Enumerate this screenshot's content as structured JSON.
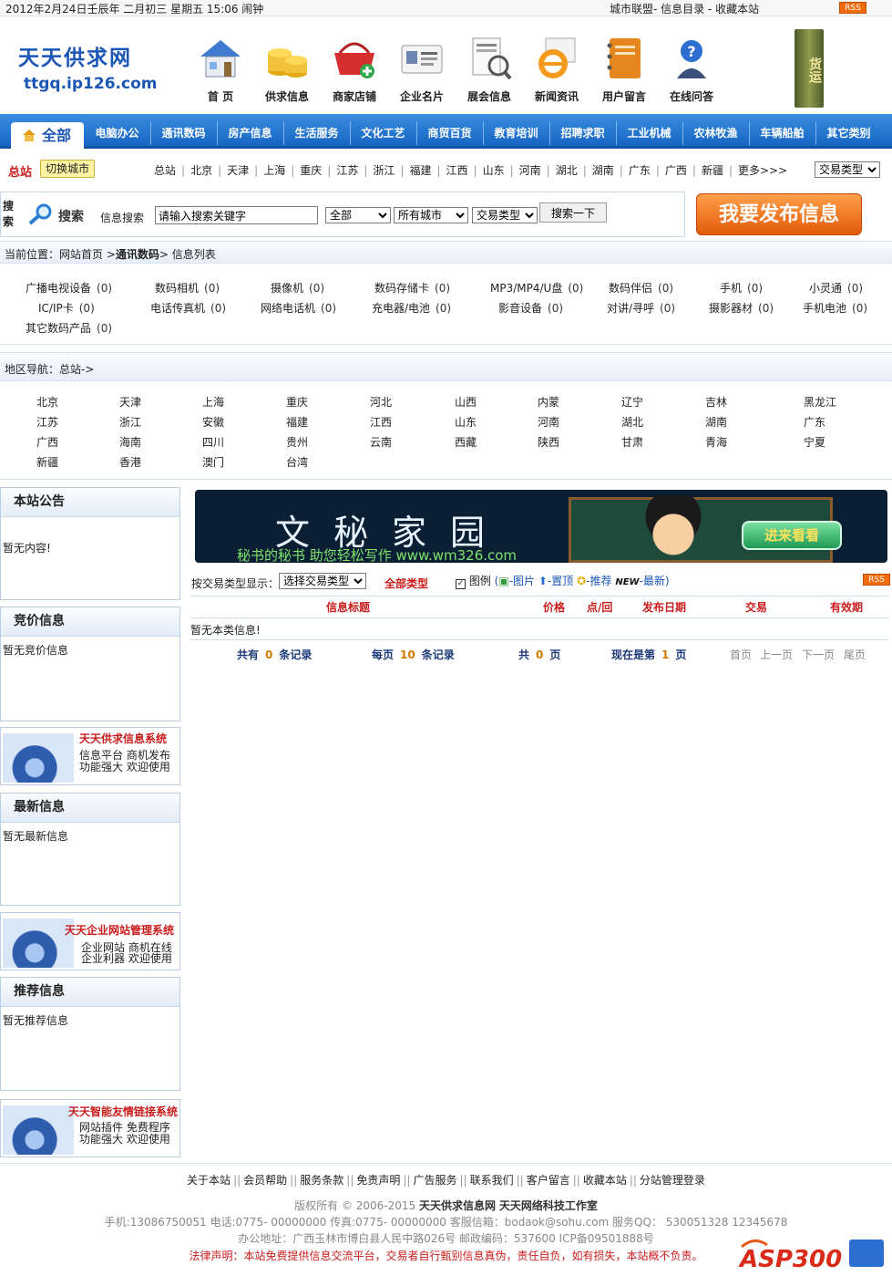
{
  "topbar": {
    "date": "2012年2月24日壬辰年 二月初三 星期五 15:06 闹钟",
    "links": "城市联盟- 信息目录 - 收藏本站",
    "rss": "RSS"
  },
  "header": {
    "logo_cn": "天天供求网",
    "logo_url": "ttgq.ip126.com",
    "nav": [
      {
        "label": "首 页",
        "icon": "house-icon"
      },
      {
        "label": "供求信息",
        "icon": "coins-icon"
      },
      {
        "label": "商家店铺",
        "icon": "basket-icon"
      },
      {
        "label": "企业名片",
        "icon": "business-card-icon"
      },
      {
        "label": "展会信息",
        "icon": "document-barcode-icon"
      },
      {
        "label": "新闻资讯",
        "icon": "news-e-icon"
      },
      {
        "label": "用户留言",
        "icon": "notebook-icon"
      },
      {
        "label": "在线问答",
        "icon": "help-person-icon"
      }
    ],
    "ad_right": "货运"
  },
  "categories": {
    "all": "全部",
    "items": [
      "电脑办公",
      "通讯数码",
      "房产信息",
      "生活服务",
      "文化工艺",
      "商贸百货",
      "教育培训",
      "招聘求职",
      "工业机械",
      "农林牧渔",
      "车辆船舶",
      "其它类别"
    ]
  },
  "cityrow": {
    "label": "总站",
    "switch": "切换城市",
    "cities": [
      "总站",
      "北京",
      "天津",
      "上海",
      "重庆",
      "江苏",
      "浙江",
      "福建",
      "江西",
      "山东",
      "河南",
      "湖北",
      "湖南",
      "广东",
      "广西",
      "新疆"
    ],
    "more": "更多>>>",
    "trade_select": "交易类型"
  },
  "search": {
    "sou": "搜索",
    "title": "搜索",
    "label": "信息搜索",
    "keyword": "请输入搜索关键字",
    "scope": "全部",
    "city": "所有城市",
    "trade": "交易类型",
    "button": "搜索一下",
    "publish": "我要发布信息"
  },
  "crumb": {
    "prefix": "当前位置：",
    "home": "网站首页",
    "sep": " >",
    "cat": "通讯数码",
    "sep2": "> ",
    "page": "信息列表"
  },
  "subcats": [
    {
      "name": "广播电视设备",
      "count": "(0)"
    },
    {
      "name": "数码相机",
      "count": "(0)"
    },
    {
      "name": "摄像机",
      "count": "(0)"
    },
    {
      "name": "数码存储卡",
      "count": "(0)"
    },
    {
      "name": "MP3/MP4/U盘",
      "count": "(0)"
    },
    {
      "name": "数码伴侣",
      "count": "(0)"
    },
    {
      "name": "手机",
      "count": "(0)"
    },
    {
      "name": "小灵通",
      "count": "(0)"
    },
    {
      "name": "IC/IP卡",
      "count": "(0)"
    },
    {
      "name": "电话传真机",
      "count": "(0)"
    },
    {
      "name": "网络电话机",
      "count": "(0)"
    },
    {
      "name": "充电器/电池",
      "count": "(0)"
    },
    {
      "name": "影音设备",
      "count": "(0)"
    },
    {
      "name": "对讲/寻呼",
      "count": "(0)"
    },
    {
      "name": "摄影器材",
      "count": "(0)"
    },
    {
      "name": "手机电池",
      "count": "(0)"
    },
    {
      "name": "其它数码产品",
      "count": "(0)"
    }
  ],
  "region": {
    "label": "地区导航：总站->",
    "provinces": [
      "北京",
      "天津",
      "上海",
      "重庆",
      "河北",
      "山西",
      "内蒙",
      "辽宁",
      "吉林",
      "黑龙江",
      "江苏",
      "浙江",
      "安徽",
      "福建",
      "江西",
      "山东",
      "河南",
      "湖北",
      "湖南",
      "广东",
      "广西",
      "海南",
      "四川",
      "贵州",
      "云南",
      "西藏",
      "陕西",
      "甘肃",
      "青海",
      "宁夏",
      "新疆",
      "香港",
      "澳门",
      "台湾"
    ]
  },
  "sidebar": {
    "notice": {
      "title": "本站公告",
      "body": "暂无内容!"
    },
    "bid": {
      "title": "竞价信息",
      "body": "暂无竞价信息"
    },
    "promo1": {
      "title": "天天供求信息系统",
      "line1": "信息平台 商机发布",
      "line2": "功能强大 欢迎使用"
    },
    "latest": {
      "title": "最新信息",
      "body": "暂无最新信息"
    },
    "promo2": {
      "title": "天天企业网站管理系统",
      "line1": "企业网站 商机在线",
      "line2": "企业利器 欢迎使用"
    },
    "recommend": {
      "title": "推荐信息",
      "body": "暂无推荐信息"
    },
    "promo3": {
      "title": "天天智能友情链接系统",
      "line1": "网站插件 免费程序",
      "line2": "功能强大 欢迎使用"
    }
  },
  "banner": {
    "title": "文秘家园",
    "subtitle": "秘书的秘书  助您轻松写作  www.wm326.com",
    "enter": "进来看看"
  },
  "listing": {
    "filter_label": "按交易类型显示：",
    "filter_select": "选择交易类型",
    "all_types": "全部类型",
    "legend_label": "图例",
    "legend_pic": "-图片",
    "legend_top": "-置顶",
    "legend_rec": "-推荐",
    "legend_new": "-最新",
    "new_badge": "NEW",
    "rss": "RSS",
    "headers": {
      "title": "信息标题",
      "price": "价格",
      "clicks": "点/回",
      "date": "发布日期",
      "trade": "交易",
      "valid": "有效期"
    },
    "empty": "暂无本类信息!",
    "pager": {
      "total_pre": "共有",
      "total": "0",
      "total_post": "条记录",
      "per_pre": "每页",
      "per": "10",
      "per_post": "条记录",
      "pages_pre": "共",
      "pages": "0",
      "pages_post": "页",
      "cur_pre": "现在是第",
      "cur": "1",
      "cur_post": "页",
      "first": "首页",
      "prev": "上一页",
      "next": "下一页",
      "last": "尾页"
    }
  },
  "footer": {
    "links": [
      "关于本站",
      "会员帮助",
      "服务条款",
      "免责声明",
      "广告服务",
      "联系我们",
      "客户留言",
      "收藏本站",
      "分站管理登录"
    ],
    "copyright_pre": "版权所有 © 2006-2015",
    "site": "天天供求信息网",
    "studio": "天天网络科技工作室",
    "contact": "手机:13086750051   电话:0775- 00000000 传真:0775- 00000000 客服信箱：bodaok@sohu.com 服务QQ： 530051328 12345678",
    "address": "办公地址：广西玉林市博白县人民中路026号 邮政编码：537600 ICP备09501888号",
    "legal": "法律声明：本站免费提供信息交流平台，交易者自行甄别信息真伪，责任自负，如有损失，本站概不负责。",
    "watermark": "ASP300源码"
  },
  "colors": {
    "brand_blue": "#1b55b5",
    "nav_blue": "#1766c2",
    "accent_red": "#c91d1d",
    "publish_orange": "#e25a0a"
  }
}
